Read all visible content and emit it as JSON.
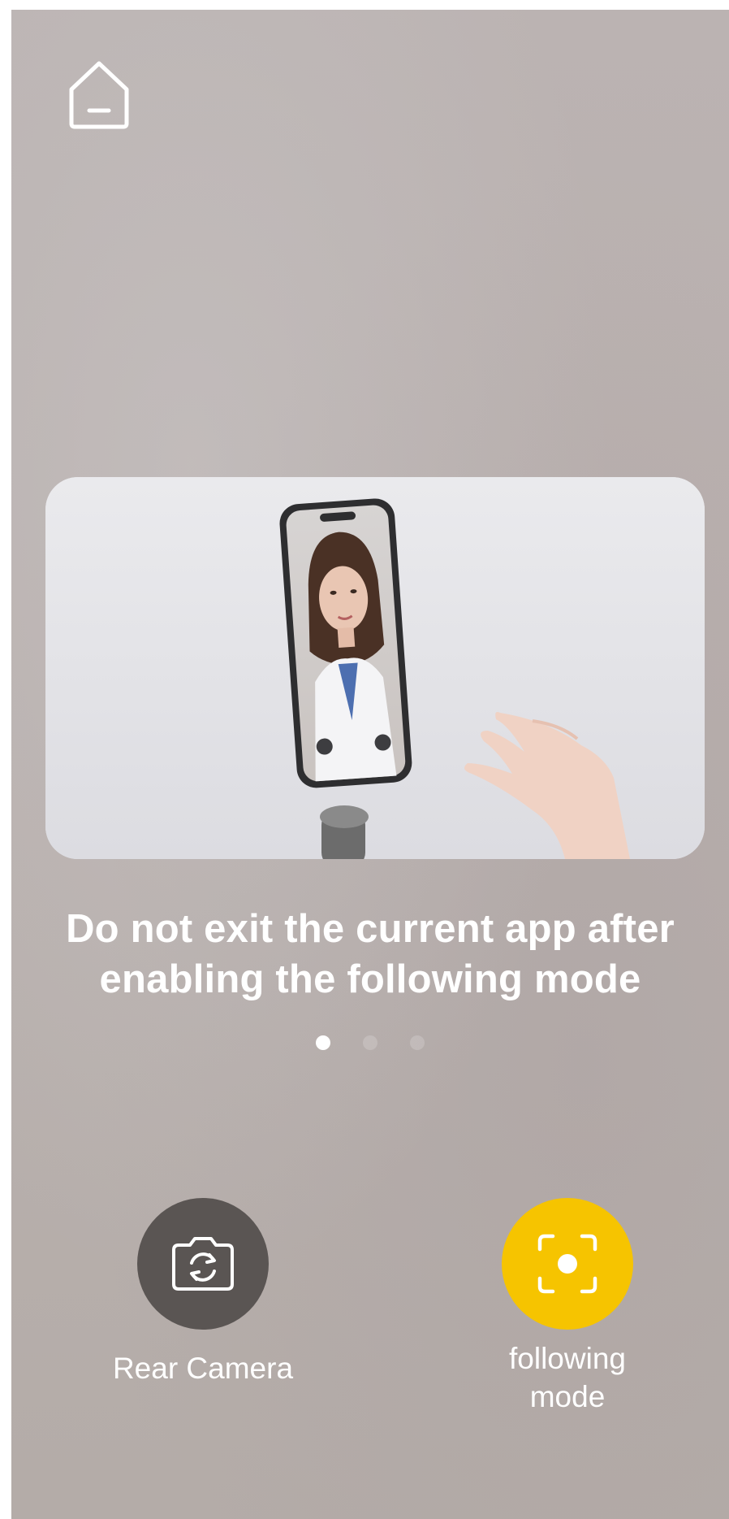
{
  "header": {
    "home_icon": "home-icon"
  },
  "tutorial": {
    "message": "Do not exit the current app after enabling the following mode",
    "pager": {
      "total": 3,
      "current": 1
    }
  },
  "actions": {
    "rear_camera": {
      "label": "Rear Camera",
      "icon": "camera-switch-icon",
      "color": "#5a5553"
    },
    "following_mode": {
      "label": "following\nmode",
      "icon": "focus-target-icon",
      "color": "#f6c400"
    }
  }
}
